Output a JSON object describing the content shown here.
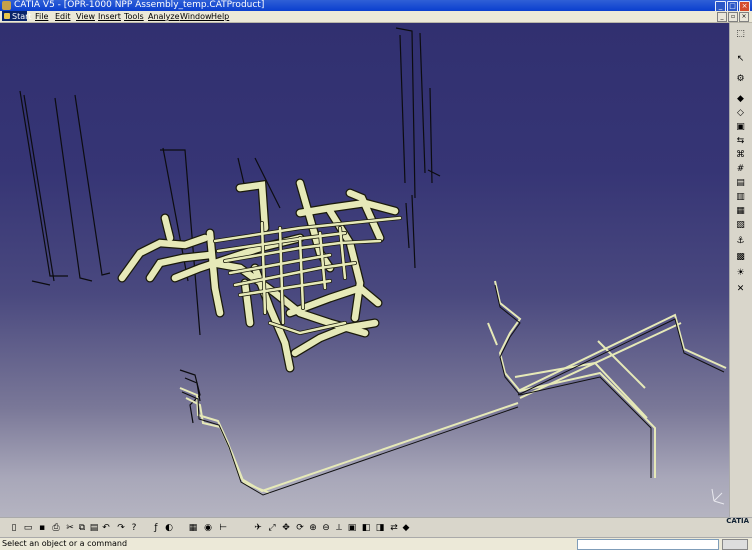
{
  "window": {
    "title": "CATIA V5 - [OPR-1000 NPP Assembly_temp.CATProduct]"
  },
  "menu": {
    "start": "Start",
    "items": [
      "File",
      "Edit",
      "View",
      "Insert",
      "Tools",
      "Analyze",
      "Window",
      "Help"
    ]
  },
  "status": {
    "message": "Select an object or a command"
  },
  "brand": {
    "logo_text": "CATIA"
  },
  "colors": {
    "viewport_top": "#313070",
    "viewport_bottom": "#b5b4c1",
    "pipe_fill": "#e6e9b8",
    "pipe_outline": "#1a1a0a"
  },
  "icons": {
    "right_toolbar": [
      "select-icon",
      "workbench-icon",
      "product-icon",
      "part-icon",
      "component-icon",
      "replace-icon",
      "graph-tree-icon",
      "generate-numbering-icon",
      "selective-load-icon",
      "manage-representations-icon",
      "multi-instantiation-icon",
      "constraint-icon",
      "fix-icon",
      "scene-icon",
      "sun-icon",
      "cancel-icon"
    ],
    "bottom_toolbar": [
      "new-icon",
      "open-icon",
      "save-icon",
      "print-icon",
      "cut-icon",
      "copy-icon",
      "paste-icon",
      "undo-icon",
      "redo-icon",
      "whats-this-icon",
      "formula-icon",
      "knowledge-icon",
      "catalog-icon",
      "analysis-icon",
      "measure-icon",
      "fly-icon",
      "fit-all-icon",
      "pan-icon",
      "rotate-icon",
      "zoom-in-icon",
      "zoom-out-icon",
      "normal-view-icon",
      "quick-view-icon",
      "render-style-icon",
      "hide-show-icon",
      "swap-space-icon",
      "apply-material-icon"
    ]
  }
}
